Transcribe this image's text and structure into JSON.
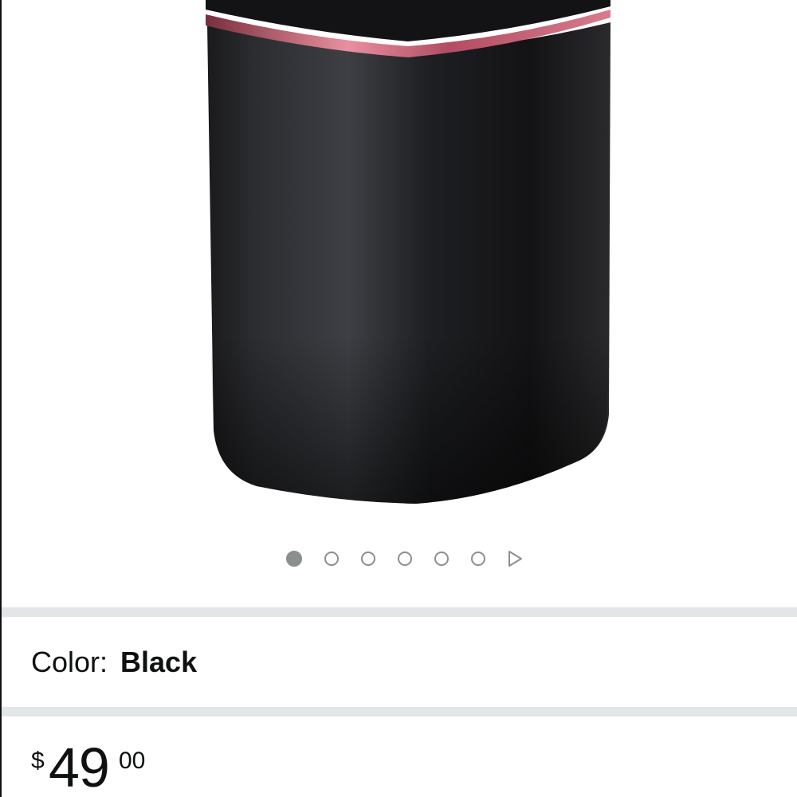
{
  "product": {
    "image_alt": "",
    "carousel": {
      "total_dots": 6,
      "active_index": 0,
      "next_icon": "play-triangle-icon"
    },
    "ring_color": "#e07a8c",
    "body_color": "#1c1c1e"
  },
  "color_selector": {
    "label": "Color:",
    "value": "Black"
  },
  "price": {
    "symbol": "$",
    "whole": "49",
    "fraction": "00"
  },
  "colors": {
    "divider": "#e3e6e6",
    "dot": "#8a8f8f",
    "text": "#0f1111"
  }
}
